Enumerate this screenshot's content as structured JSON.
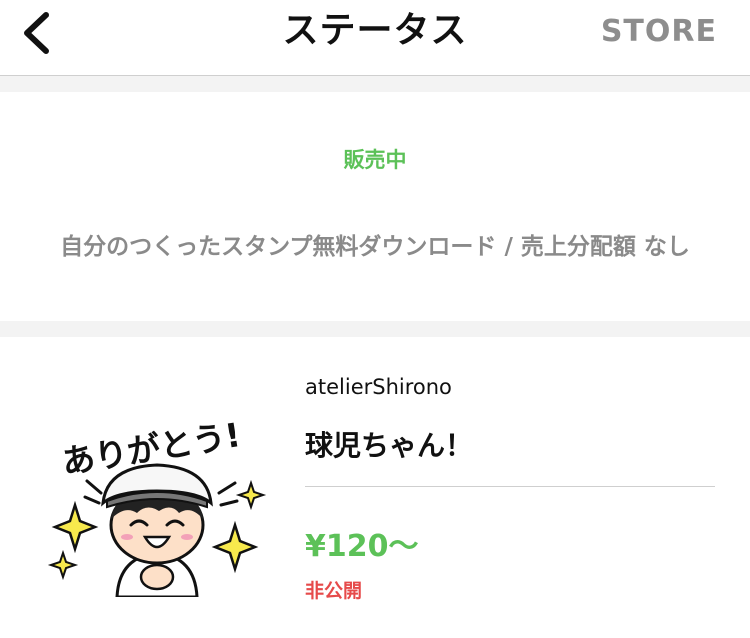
{
  "header": {
    "title": "ステータス",
    "store_label": "STORE"
  },
  "status": {
    "label": "販売中",
    "description": "自分のつくったスタンプ無料ダウンロード / 売上分配額 なし"
  },
  "product": {
    "sticker_text": "ありがとう!",
    "author": "atelierShirono",
    "name": "球児ちゃん！",
    "price": "¥120～",
    "visibility": "非公開"
  },
  "colors": {
    "accent_green": "#5cc158",
    "alert_red": "#e64a4a",
    "muted_gray": "#8a8a8a"
  }
}
